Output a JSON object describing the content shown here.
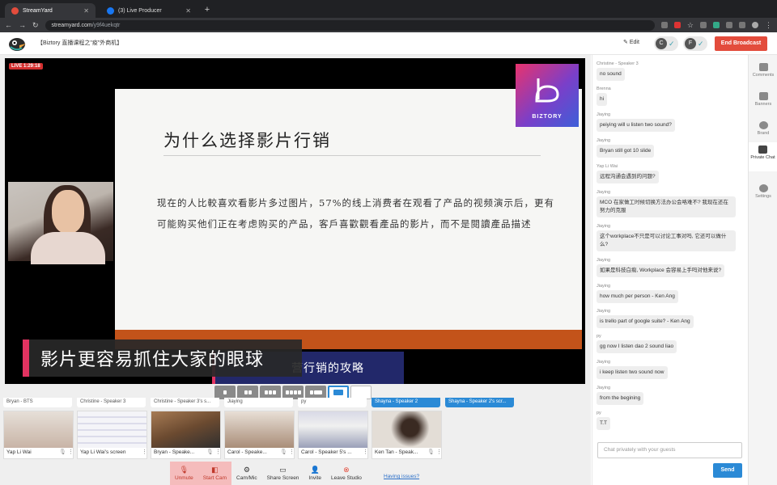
{
  "browser": {
    "tabs": [
      {
        "title": "StreamYard",
        "fav_color": "#e34c3c",
        "active": true
      },
      {
        "title": "(3) Live Producer",
        "fav_color": "#1877f2",
        "active": false
      }
    ],
    "url_host": "streamyard.com",
    "url_path": "/y9f4uekqtr"
  },
  "header": {
    "broadcast_title": "【Biztory 直播课程之\"疫\"外商机】",
    "edit_label": "Edit",
    "guests": [
      {
        "initial": "C"
      },
      {
        "initial": "F"
      }
    ],
    "end_label": "End Broadcast"
  },
  "stage": {
    "live_badge": "LIVE 1:29:18",
    "slide_title": "为什么选择影片行销",
    "slide_body": "现在的人比較喜欢看影片多过图片，57%的线上消费者在观看了产品的视频演示后，更有可能购买他们正在考虑购买的产品，客戶喜歡觀看產品的影片，而不是閱讀產品描述",
    "logo_text": "BIZTORY",
    "banner_text": "营行销的攻略",
    "caption_text": "影片更容易抓住大家的眼球",
    "colors": {
      "slide_bar": "#c3531a",
      "banner": "#22286a",
      "accent": "#e23361"
    }
  },
  "layout_options": [
    "single",
    "two",
    "three",
    "four",
    "side-by-side",
    "picture-in-picture",
    "fullscreen"
  ],
  "participant_labels": [
    {
      "name": "Bryan - BTS",
      "highlight": false
    },
    {
      "name": "Christine - Speaker 3",
      "highlight": false
    },
    {
      "name": "Christine - Speaker 3's s...",
      "highlight": false
    },
    {
      "name": "Jiaying",
      "highlight": false
    },
    {
      "name": "py",
      "highlight": false
    },
    {
      "name": "Shayna - Speaker 2",
      "highlight": true
    },
    {
      "name": "Shayna - Speaker 2's scr...",
      "highlight": true
    }
  ],
  "participants": [
    {
      "name": "Yap Li Wai",
      "bg": "#d9cfc6"
    },
    {
      "name": "Yap Li Wai's screen",
      "bg": "#ecebf2"
    },
    {
      "name": "Bryan - Speake...",
      "bg": "#8a6a4a"
    },
    {
      "name": "Carol - Speake...",
      "bg": "#bfa896"
    },
    {
      "name": "Carol - Speaker 5's ...",
      "bg": "#dcdde6"
    },
    {
      "name": "Ken Tan - Speak...",
      "bg": "#d8d2cc"
    }
  ],
  "toolbar": {
    "unmute": "Unmute",
    "start_cam": "Start Cam",
    "cam_mic": "Cam/Mic",
    "share_screen": "Share Screen",
    "invite": "Invite",
    "leave": "Leave Studio",
    "issues": "Having issues?"
  },
  "chat": {
    "messages": [
      {
        "author": "Christine - Speaker 3",
        "text": "no sound"
      },
      {
        "author": "Brenna",
        "text": "hi"
      },
      {
        "author": "Jiaying",
        "text": "peiying will u listen two sound?"
      },
      {
        "author": "Jiaying",
        "text": "Bryan still got 10 slide"
      },
      {
        "author": "Yap Li Wai",
        "text": "远程沟通会遇到的问题?"
      },
      {
        "author": "Jiaying",
        "text": "MCO 在家做工时候切换方法办公会咯难不? 我现在还在努力的克服"
      },
      {
        "author": "Jiaying",
        "text": "这个workplace不只是可以讨论工事对吗, 它还可以做什么?"
      },
      {
        "author": "Jiaying",
        "text": "如果是科技白痴, Workplace 会容易上手吗对他来说?"
      },
      {
        "author": "Jiaying",
        "text": "how much per person - Ken Ang"
      },
      {
        "author": "Jiaying",
        "text": "is trello part of google suite? - Ken Ang"
      },
      {
        "author": "py",
        "text": "gg now I listen dao 2 sound liao"
      },
      {
        "author": "Jiaying",
        "text": "i keep listen two sound now"
      },
      {
        "author": "Jiaying",
        "text": "from the begining"
      },
      {
        "author": "py",
        "text": "T.T"
      }
    ],
    "placeholder": "Chat privately with your guests",
    "send": "Send"
  },
  "rail": [
    {
      "label": "Comments",
      "active": false
    },
    {
      "label": "Banners",
      "active": false
    },
    {
      "label": "Brand",
      "active": false
    },
    {
      "label": "Private Chat",
      "active": true
    },
    {
      "label": "Settings",
      "active": false
    }
  ]
}
